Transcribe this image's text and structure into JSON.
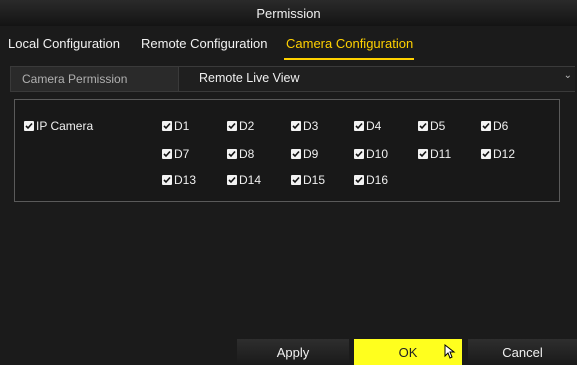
{
  "window": {
    "title": "Permission"
  },
  "tabs": [
    {
      "label": "Local Configuration",
      "active": false
    },
    {
      "label": "Remote Configuration",
      "active": false
    },
    {
      "label": "Camera Configuration",
      "active": true
    }
  ],
  "permission": {
    "label": "Camera Permission",
    "selected": "Remote Live View"
  },
  "camera_group": {
    "label": "IP Camera",
    "checked": true,
    "cameras": [
      "D1",
      "D2",
      "D3",
      "D4",
      "D5",
      "D6",
      "D7",
      "D8",
      "D9",
      "D10",
      "D11",
      "D12",
      "D13",
      "D14",
      "D15",
      "D16"
    ]
  },
  "buttons": {
    "apply": "Apply",
    "ok": "OK",
    "cancel": "Cancel"
  },
  "colors": {
    "accent": "#ffd100",
    "ok_button": "#ffff1e",
    "background": "#1b1b1b"
  }
}
